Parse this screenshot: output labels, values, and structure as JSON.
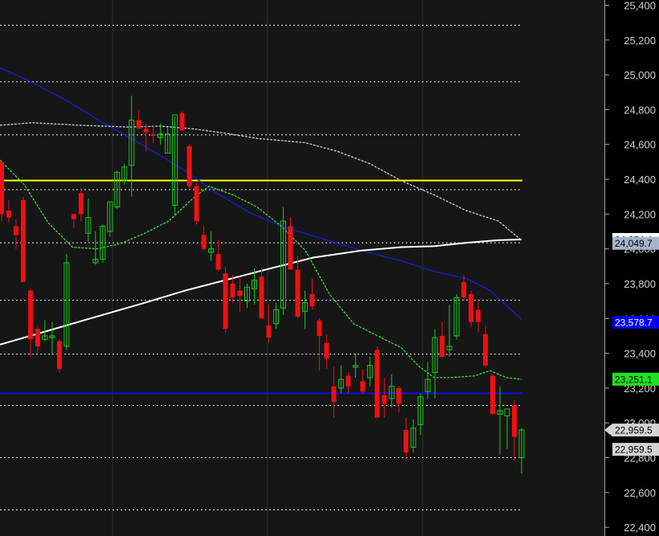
{
  "chart_data": {
    "type": "candlestick",
    "ylim": [
      22350,
      25430
    ],
    "y_ticks": [
      "25,400",
      "25,200",
      "25,000",
      "24,800",
      "24,600",
      "24,400",
      "24,200",
      "24,000",
      "23,800",
      "23,600",
      "23,400",
      "23,200",
      "23,000",
      "22,800",
      "22,600",
      "22,400"
    ],
    "dotted_levels": [
      25285,
      24960,
      24655,
      24340,
      24035,
      23705,
      23395,
      23100,
      22800,
      22500
    ],
    "horizontal_lines": [
      {
        "value": 24393,
        "color": "#ffff00"
      },
      {
        "value": 23170,
        "color": "#1010e0"
      }
    ],
    "candles": [
      [
        24500,
        24510,
        24160,
        24200
      ],
      [
        24220,
        24280,
        24150,
        24180
      ],
      [
        24130,
        24170,
        24000,
        24080
      ],
      [
        24280,
        24300,
        23900,
        23810
      ],
      [
        23760,
        23770,
        23380,
        23480
      ],
      [
        23540,
        23560,
        23400,
        23440
      ],
      [
        23480,
        23590,
        23470,
        23500
      ],
      [
        23490,
        23580,
        23390,
        23500
      ],
      [
        23470,
        23480,
        23290,
        23310
      ],
      [
        23440,
        23970,
        23420,
        23920
      ],
      [
        24200,
        24200,
        24120,
        24170
      ],
      [
        24320,
        24350,
        24160,
        24200
      ],
      [
        24090,
        24290,
        24040,
        24180
      ],
      [
        23920,
        24100,
        23910,
        23940
      ],
      [
        23940,
        24140,
        23920,
        24130
      ],
      [
        24100,
        24270,
        24070,
        24270
      ],
      [
        24240,
        24450,
        24230,
        24440
      ],
      [
        24390,
        24490,
        24370,
        24470
      ],
      [
        24480,
        24880,
        24300,
        24740
      ],
      [
        24740,
        24800,
        24690,
        24690
      ],
      [
        24690,
        24720,
        24560,
        24670
      ],
      [
        24660,
        24710,
        24610,
        24650
      ],
      [
        24640,
        24720,
        24600,
        24660
      ],
      [
        24550,
        24700,
        24550,
        24660
      ],
      [
        24250,
        24760,
        24190,
        24770
      ],
      [
        24780,
        24790,
        24680,
        24680
      ],
      [
        24590,
        24600,
        24350,
        24360
      ],
      [
        24360,
        24380,
        24140,
        24160
      ],
      [
        24080,
        24130,
        23990,
        24000
      ],
      [
        23980,
        24100,
        23930,
        24000
      ],
      [
        23970,
        24050,
        23870,
        23880
      ],
      [
        23860,
        23900,
        23520,
        23540
      ],
      [
        23800,
        23850,
        23690,
        23720
      ],
      [
        23760,
        23830,
        23640,
        23730
      ],
      [
        23700,
        23800,
        23660,
        23780
      ],
      [
        23770,
        23890,
        23680,
        23820
      ],
      [
        23840,
        23890,
        23620,
        23600
      ],
      [
        23560,
        23680,
        23460,
        23490
      ],
      [
        23570,
        23690,
        23540,
        23650
      ],
      [
        23660,
        24240,
        23620,
        24160
      ],
      [
        24130,
        24180,
        23890,
        23880
      ],
      [
        23880,
        23960,
        23600,
        23610
      ],
      [
        23640,
        23760,
        23540,
        23690
      ],
      [
        23740,
        23830,
        23650,
        23670
      ],
      [
        23590,
        23600,
        23300,
        23500
      ],
      [
        23460,
        23510,
        23310,
        23370
      ],
      [
        23210,
        23320,
        23030,
        23120
      ],
      [
        23200,
        23330,
        23170,
        23250
      ],
      [
        23270,
        23290,
        23170,
        23210
      ],
      [
        23320,
        23400,
        23260,
        23330
      ],
      [
        23240,
        23310,
        23170,
        23180
      ],
      [
        23260,
        23380,
        23210,
        23330
      ],
      [
        23420,
        23440,
        23060,
        23030
      ],
      [
        23160,
        23260,
        23030,
        23110
      ],
      [
        23140,
        23280,
        23090,
        23210
      ],
      [
        23200,
        23210,
        23060,
        23110
      ],
      [
        22960,
        23030,
        22780,
        22830
      ],
      [
        22860,
        23020,
        22830,
        22970
      ],
      [
        22990,
        23170,
        22930,
        23150
      ],
      [
        23180,
        23350,
        23140,
        23250
      ],
      [
        23290,
        23540,
        23140,
        23490
      ],
      [
        23500,
        23580,
        23380,
        23380
      ],
      [
        23420,
        23680,
        23380,
        23440
      ],
      [
        23500,
        23740,
        23480,
        23720
      ],
      [
        23810,
        23850,
        23700,
        23720
      ],
      [
        23740,
        23760,
        23550,
        23580
      ],
      [
        23650,
        23700,
        23520,
        23580
      ],
      [
        23510,
        23560,
        23320,
        23330
      ],
      [
        23270,
        23280,
        23050,
        23050
      ],
      [
        23050,
        23210,
        22820,
        23070
      ],
      [
        23040,
        23040,
        22850,
        23080
      ],
      [
        23100,
        23130,
        22780,
        22920
      ],
      [
        22800,
        22970,
        22710,
        22960
      ]
    ],
    "moving_averages": [
      {
        "color": "#1a1ad8",
        "points": [
          [
            0,
            25040
          ],
          [
            30,
            24980
          ],
          [
            80,
            24860
          ],
          [
            130,
            24720
          ],
          [
            180,
            24590
          ],
          [
            230,
            24450
          ],
          [
            270,
            24320
          ],
          [
            310,
            24210
          ],
          [
            350,
            24130
          ],
          [
            400,
            24060
          ],
          [
            450,
            23990
          ],
          [
            500,
            23930
          ],
          [
            540,
            23870
          ],
          [
            580,
            23830
          ],
          [
            610,
            23760
          ],
          [
            649,
            23595
          ]
        ]
      },
      {
        "color": "#b8d0e8",
        "points": [
          [
            0,
            24710
          ],
          [
            40,
            24725
          ],
          [
            100,
            24710
          ],
          [
            160,
            24700
          ],
          [
            200,
            24705
          ],
          [
            240,
            24690
          ],
          [
            280,
            24665
          ],
          [
            320,
            24635
          ],
          [
            380,
            24610
          ],
          [
            420,
            24560
          ],
          [
            460,
            24490
          ],
          [
            500,
            24390
          ],
          [
            540,
            24310
          ],
          [
            580,
            24220
          ],
          [
            620,
            24160
          ],
          [
            649,
            24050
          ]
        ]
      },
      {
        "color": "#ffffff",
        "points": [
          [
            0,
            23450
          ],
          [
            60,
            23530
          ],
          [
            120,
            23610
          ],
          [
            180,
            23690
          ],
          [
            230,
            23760
          ],
          [
            280,
            23820
          ],
          [
            330,
            23880
          ],
          [
            390,
            23950
          ],
          [
            450,
            23990
          ],
          [
            500,
            24010
          ],
          [
            540,
            24015
          ],
          [
            580,
            24035
          ],
          [
            620,
            24050
          ],
          [
            649,
            24054
          ]
        ]
      },
      {
        "color": "#38e038",
        "points": [
          [
            0,
            24510
          ],
          [
            30,
            24370
          ],
          [
            60,
            24150
          ],
          [
            90,
            24010
          ],
          [
            120,
            24000
          ],
          [
            150,
            24030
          ],
          [
            180,
            24090
          ],
          [
            210,
            24160
          ],
          [
            240,
            24290
          ],
          [
            260,
            24360
          ],
          [
            290,
            24310
          ],
          [
            320,
            24240
          ],
          [
            350,
            24130
          ],
          [
            380,
            23990
          ],
          [
            410,
            23740
          ],
          [
            440,
            23570
          ],
          [
            470,
            23500
          ],
          [
            500,
            23430
          ],
          [
            520,
            23330
          ],
          [
            540,
            23260
          ],
          [
            560,
            23260
          ],
          [
            590,
            23270
          ],
          [
            610,
            23300
          ],
          [
            630,
            23260
          ],
          [
            649,
            23251
          ]
        ]
      }
    ],
    "price_tags": [
      {
        "text": "24,054.4",
        "value": 24054,
        "bg": "#ffffff",
        "fg": "#000000",
        "pointer": false
      },
      {
        "text": "24,049.7",
        "value": 24032,
        "bg": "#a6b4cc",
        "fg": "#000000",
        "pointer": false
      },
      {
        "text": "23,578.7",
        "value": 23578,
        "bg": "#0000ee",
        "fg": "#ffffff",
        "pointer": false
      },
      {
        "text": "23,251.1",
        "value": 23251,
        "bg": "#1ee01e",
        "fg": "#000000",
        "pointer": false
      },
      {
        "text": "22,959.5",
        "value": 22959,
        "bg": "#d4d4d4",
        "fg": "#000000",
        "pointer": true
      },
      {
        "text": "22,959.5",
        "value": 22848,
        "bg": "#d4d4d4",
        "fg": "#000000",
        "pointer": false
      }
    ],
    "colors": {
      "up": "#1ec81e",
      "down": "#ee1111",
      "grid": "#2e2e2e",
      "panel": "#161616"
    }
  }
}
